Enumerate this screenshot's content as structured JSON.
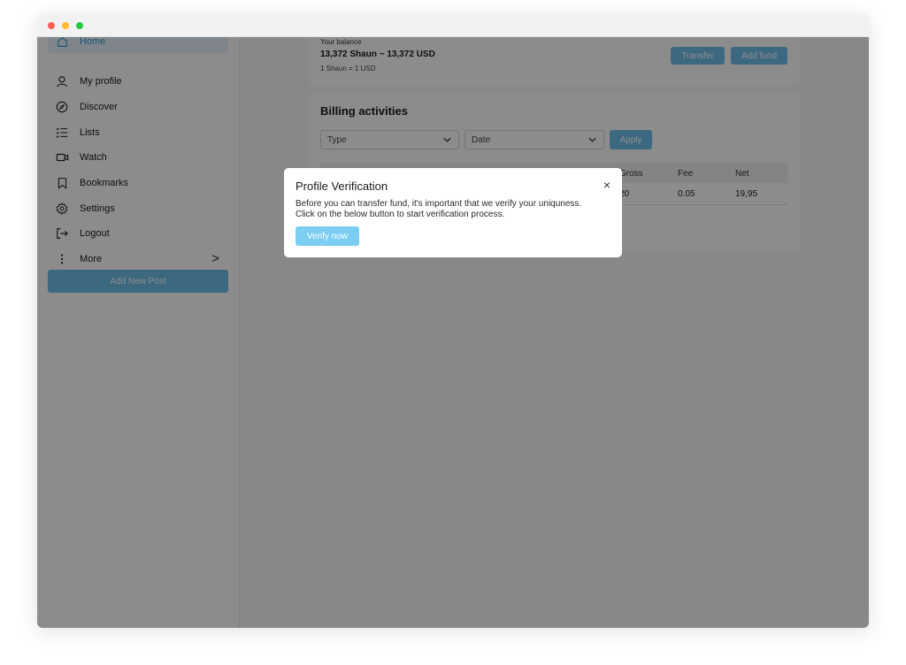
{
  "window": {
    "controls": [
      "close",
      "minimize",
      "maximize"
    ]
  },
  "sidebar": {
    "items": [
      {
        "label": "Home",
        "icon": "home-icon",
        "active": true
      },
      {
        "label": "My profile",
        "icon": "user-icon"
      },
      {
        "label": "Discover",
        "icon": "compass-icon"
      },
      {
        "label": "Lists",
        "icon": "list-icon"
      },
      {
        "label": "Watch",
        "icon": "video-icon"
      },
      {
        "label": "Bookmarks",
        "icon": "bookmark-icon"
      },
      {
        "label": "Settings",
        "icon": "gear-icon"
      },
      {
        "label": "Logout",
        "icon": "logout-icon"
      },
      {
        "label": "More",
        "icon": "more-icon",
        "chevron": ">"
      }
    ],
    "add_post_label": "Add New Post"
  },
  "balance": {
    "label": "Your balance",
    "amount": "13,372 Shaun ~ 13,372 USD",
    "rate": "1 Shaun = 1 USD",
    "transfer_label": "Transfer",
    "add_fund_label": "Add fund"
  },
  "billing": {
    "title": "Billing activities",
    "type_select": {
      "value": "Type"
    },
    "date_select": {
      "value": "Date"
    },
    "apply_label": "Apply",
    "columns": [
      "Gross",
      "Fee",
      "Net"
    ],
    "rows": [
      {
        "gross": "20",
        "fee": "0.05",
        "net": "19,95"
      }
    ]
  },
  "modal": {
    "title": "Profile Verification",
    "close_glyph": "×",
    "line1": "Before you can transfer fund, it's important that we verify your uniquness.",
    "line2": "Click on the below button to start verification process.",
    "verify_label": "Verify now"
  },
  "colors": {
    "accent": "#6fbfe9",
    "active_bg": "#e8f3fb",
    "overlay": "rgba(0,0,0,0.45)"
  }
}
